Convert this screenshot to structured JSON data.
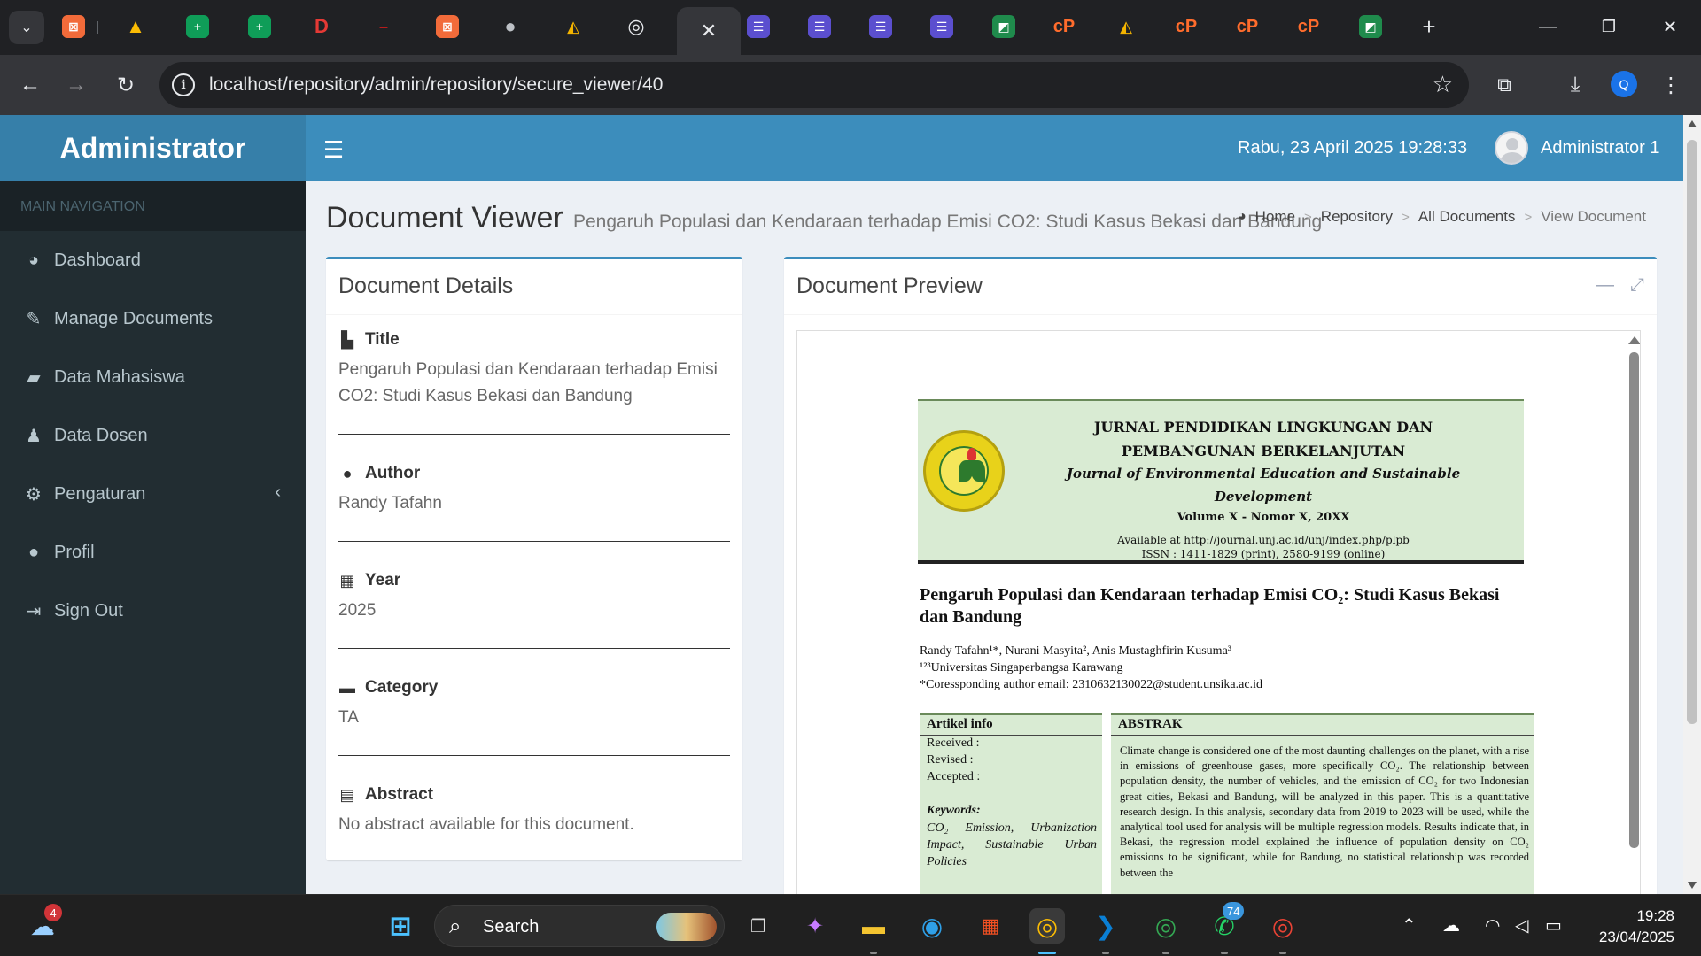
{
  "browser": {
    "url": "localhost/repository/admin/repository/secure_viewer/40",
    "profile_initial": "Q",
    "colors": {
      "tabbar": "#202124",
      "toolbar": "#35363a"
    }
  },
  "header": {
    "brand": "Administrator",
    "datetime": "Rabu, 23 April 2025 19:28:33",
    "user_name": "Administrator 1"
  },
  "sidebar": {
    "section_label": "MAIN NAVIGATION",
    "items": [
      {
        "label": "Dashboard",
        "icon": "dashboard-icon"
      },
      {
        "label": "Manage Documents",
        "icon": "edit-icon"
      },
      {
        "label": "Data Mahasiswa",
        "icon": "graduation-cap-icon"
      },
      {
        "label": "Data Dosen",
        "icon": "users-icon"
      },
      {
        "label": "Pengaturan",
        "icon": "cogs-icon"
      },
      {
        "label": "Profil",
        "icon": "user-icon"
      },
      {
        "label": "Sign Out",
        "icon": "sign-out-icon"
      }
    ]
  },
  "page": {
    "title": "Document Viewer",
    "subtitle": "Pengaruh Populasi dan Kendaraan terhadap Emisi CO2: Studi Kasus Bekasi dan Bandung",
    "breadcrumb": [
      "Home",
      "Repository",
      "All Documents",
      "View Document"
    ]
  },
  "details": {
    "box_title": "Document Details",
    "title_label": "Title",
    "title_value": "Pengaruh Populasi dan Kendaraan terhadap Emisi CO2: Studi Kasus Bekasi dan Bandung",
    "author_label": "Author",
    "author_value": "Randy Tafahn",
    "year_label": "Year",
    "year_value": "2025",
    "category_label": "Category",
    "category_value": "TA",
    "abstract_label": "Abstract",
    "abstract_value": "No abstract available for this document."
  },
  "preview": {
    "box_title": "Document Preview",
    "journal": {
      "line1": "JURNAL PENDIDIKAN LINGKUNGAN DAN",
      "line2": "PEMBANGUNAN BERKELANJUTAN",
      "line3": "Journal of Environmental Education and Sustainable",
      "line4": "Development",
      "volume": "Volume X - Nomor X, 20XX",
      "available": "Available at http://journal.unj.ac.id/unj/index.php/plpb",
      "issn": "ISSN : 1411-1829 (print), 2580-9199 (online)"
    },
    "paper_title": "Pengaruh Populasi dan Kendaraan terhadap Emisi CO₂: Studi Kasus Bekasi dan Bandung",
    "authors": "Randy Tafahn¹*, Nurani Masyita², Anis Mustaghfirin Kusuma³",
    "affiliation": "¹²³Universitas Singaperbangsa Karawang",
    "email": "*Coressponding author email: 2310632130022@student.unsika.ac.id",
    "article_info_label": "Artikel info",
    "received": "Received   :",
    "revised": "Revised     :",
    "accepted": "Accepted  :",
    "keywords_label": "Keywords:",
    "keywords": "CO₂ Emission, Urbanization Impact, Sustainable Urban Policies",
    "abstract_label": "ABSTRAK",
    "abstract": "Climate change is considered one of the most daunting challenges on the planet, with a rise in emissions of greenhouse gases, more specifically CO₂. The relationship between population density, the number of vehicles, and the emission of CO₂ for two Indonesian great cities, Bekasi and Bandung, will be analyzed in this paper. This is a quantitative research design. In this analysis, secondary data from 2019 to 2023 will be used, while the analytical tool used for analysis will be multiple regression models. Results indicate that, in Bekasi, the regression model explained the influence of population density on CO₂ emissions to be significant, while for Bandung, no statistical relationship was recorded between the"
  },
  "taskbar": {
    "search_label": "Search",
    "weather_badge": "4",
    "whatsapp_badge": "74",
    "time": "19:28",
    "date": "23/04/2025"
  }
}
